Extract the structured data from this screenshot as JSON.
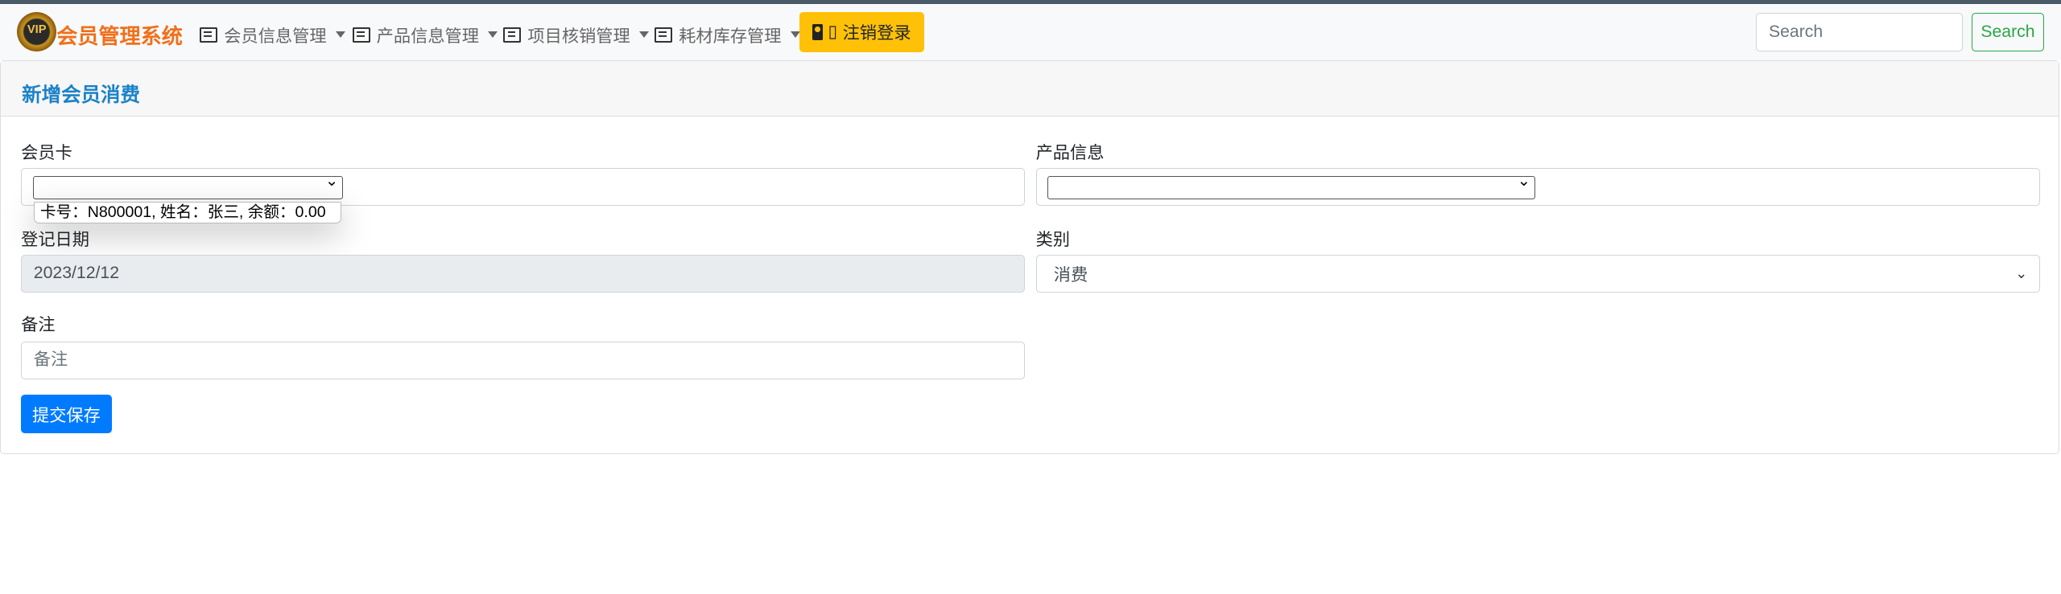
{
  "navbar": {
    "brand": "会员管理系统",
    "logo_text": "VIP",
    "items": [
      {
        "label": "会员信息管理",
        "icon": "list-card-icon"
      },
      {
        "label": "产品信息管理",
        "icon": "list-card-icon"
      },
      {
        "label": "项目核销管理",
        "icon": "list-card-icon"
      },
      {
        "label": "耗材库存管理",
        "icon": "list-card-icon"
      }
    ],
    "logout_label": "注销登录",
    "logout_glyph": "▯",
    "search_placeholder": "Search",
    "search_button": "Search"
  },
  "card": {
    "title": "新增会员消费",
    "member_card": {
      "label": "会员卡",
      "value": "",
      "dropdown_option": "卡号：N800001, 姓名：张三, 余额：0.00"
    },
    "product": {
      "label": "产品信息",
      "value": ""
    },
    "date": {
      "label": "登记日期",
      "value": "2023/12/12"
    },
    "category": {
      "label": "类别",
      "value": "消费"
    },
    "remark": {
      "label": "备注",
      "placeholder": "备注"
    },
    "submit_label": "提交保存"
  },
  "colors": {
    "brand": "#f0701a",
    "title": "#1a82c8",
    "warning": "#ffc107",
    "primary": "#007bff",
    "success": "#28a745"
  }
}
